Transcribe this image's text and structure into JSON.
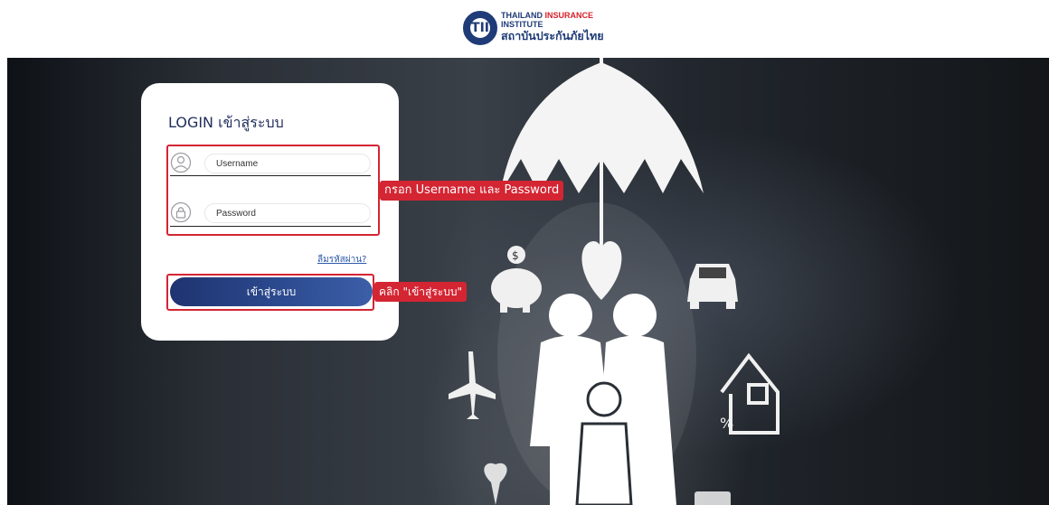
{
  "header": {
    "logo": {
      "line1_a": "THAILAND",
      "line1_b": " INSURANCE",
      "line2": "INSTITUTE",
      "line3": "สถาบันประกันภัยไทย",
      "glyph": "TII"
    }
  },
  "login": {
    "title": "LOGIN เข้าสู่ระบบ",
    "username_placeholder": "Username",
    "password_placeholder": "Password",
    "forgot_label": "ลืมรหัสผ่าน?",
    "submit_label": "เข้าสู่ระบบ"
  },
  "annotations": {
    "credentials_callout": "กรอก Username และ Password",
    "login_callout": "คลิก \"เข้าสู่ระบบ\""
  },
  "icons": [
    "user-icon",
    "lock-icon",
    "umbrella-icon",
    "heart-icon",
    "piggy-bank-icon",
    "car-icon",
    "house-icon",
    "airplane-icon",
    "family-icon"
  ],
  "colors": {
    "brand_navy": "#1f3b78",
    "brand_red": "#d6202a",
    "annotation_red": "#d42533",
    "button_gradient_start": "#1f3470",
    "button_gradient_end": "#3c5fa8",
    "link_blue": "#2d5aa8"
  }
}
